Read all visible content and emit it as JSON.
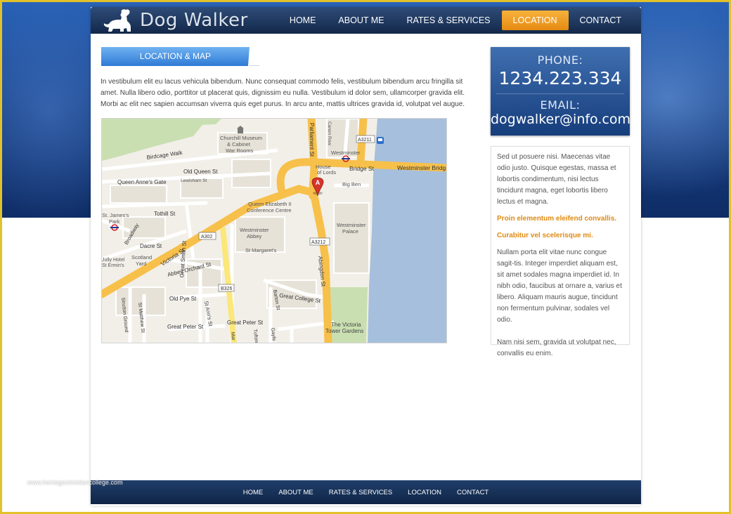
{
  "header": {
    "logo_text": "Dog Walker",
    "nav": [
      {
        "label": "HOME",
        "active": false
      },
      {
        "label": "ABOUT ME",
        "active": false
      },
      {
        "label": "RATES & SERVICES",
        "active": false
      },
      {
        "label": "LOCATION",
        "active": true
      },
      {
        "label": "CONTACT",
        "active": false
      }
    ]
  },
  "main": {
    "section_title": "LOCATION & MAP",
    "intro": "In vestibulum elit eu lacus vehicula bibendum. Nunc consequat commodo felis, vestibulum bibendum arcu fringilla sit amet. Nulla libero odio, porttitor ut placerat quis, dignissim eu nulla. Vestibulum id dolor sem, ullamcorper gravida elit. Morbi ac elit nec sapien accumsan viverra quis eget purus. In arcu ante, mattis ultrices gravida id, volutpat vel augue.",
    "map": {
      "marker_label": "A",
      "labels": {
        "churchill": "Churchill Museum",
        "cabinet": "& Cabinet",
        "war_rooms": "War Rooms",
        "birdcage": "Birdcage Walk",
        "old_queen": "Old Queen St",
        "lewisham": "Lewisham St",
        "queen_annes": "Queen Anne's Gate",
        "house_of_lords_1": "House",
        "house_of_lords_2": "of Lords",
        "westminster_stn": "Westminster",
        "bridge_st": "Bridge St",
        "westminster_bridge": "Westminster Bridg",
        "big_ben": "Big Ben",
        "parliament_st": "Parliament St",
        "canon_row": "Canon Row",
        "a3211": "A3211",
        "a302_top": "A302",
        "st_james_park_1": "St. James's",
        "st_james_park_2": "Park",
        "tothill": "Tothill St",
        "qe_centre_1": "Queen Elizabeth II",
        "qe_centre_2": "Conference Centre",
        "westminster_abbey_1": "Westminster",
        "westminster_abbey_2": "Abbey",
        "westminster_palace_1": "Westminster",
        "westminster_palace_2": "Palace",
        "broadway": "Broadway",
        "dacre": "Dacre St",
        "a302": "A302",
        "a3212": "A3212",
        "st_margarets": "St Margaret's",
        "victoria_st": "Victoria St",
        "jolly_hotel_1": "Jolly Hotel",
        "jolly_hotel_2": "St Ermin's",
        "scotland_yard_1": "Scotland",
        "scotland_yard_2": "Yard",
        "abbey_orchard": "Abbey Orchard St",
        "great_smith": "Great Smith St",
        "abingdon": "Abingdon St",
        "b326": "B326",
        "old_pye": "Old Pye St",
        "st_anns": "St Ann's St",
        "barton": "Barton St",
        "great_college": "Great College St",
        "strutton": "Strutton Ground",
        "st_matthew": "St Matthew St",
        "great_peter_left": "Great Peter St",
        "great_peter_right": "Great Peter St",
        "tufton": "Tufton",
        "gayfere": "Gayfe",
        "marsham": "Mar",
        "victoria_tower_1": "The Victoria",
        "victoria_tower_2": "Tower Gardens"
      }
    }
  },
  "sidebar": {
    "phone_label": "PHONE:",
    "phone": "1234.223.334",
    "email_label": "EMAIL:",
    "email": "dogwalker@info.com",
    "para1": "Sed ut posuere nisi. Maecenas vitae odio justo. Quisque egestas, massa et lobortis condimentum, nisi lectus tincidunt magna, eget lobortis libero lectus et magna.",
    "highlight1": "Proin elementum eleifend convallis.",
    "highlight2": "Curabitur vel scelerisque mi.",
    "para2": "Nullam porta elit vitae nunc congue sagit-tis. Integer imperdiet aliquam est, sit amet sodales magna imperdiet id. In nibh odio, faucibus at ornare a, varius et libero. Aliquam mauris augue, tincidunt non fermentum pulvinar, sodales vel odio.",
    "para3": "Nam nisi sem, gravida ut volutpat nec, convallis eu enim."
  },
  "footer": {
    "nav": [
      "HOME",
      "ABOUT ME",
      "RATES & SERVICES",
      "LOCATION",
      "CONTACT"
    ]
  },
  "watermark": "www.heritagechristiancollege.com",
  "colors": {
    "accent_orange": "#e58a12",
    "header_dark": "#13284a",
    "water": "#a6bfdc",
    "road_major": "#f7c04a",
    "road_secondary": "#fbe77a"
  }
}
